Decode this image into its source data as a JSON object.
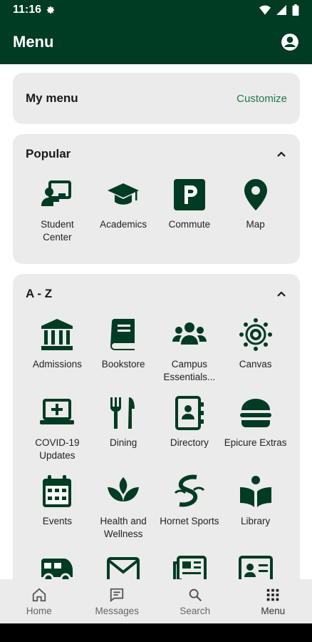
{
  "status": {
    "time": "11:16"
  },
  "appbar": {
    "title": "Menu",
    "account_icon": "account-circle-icon"
  },
  "mymenu": {
    "title": "My menu",
    "customize": "Customize"
  },
  "popular": {
    "title": "Popular",
    "items": [
      {
        "label": "Student Center",
        "icon": "student-center-icon"
      },
      {
        "label": "Academics",
        "icon": "graduation-cap-icon"
      },
      {
        "label": "Commute",
        "icon": "parking-icon"
      },
      {
        "label": "Map",
        "icon": "map-pin-icon"
      }
    ]
  },
  "az": {
    "title": "A - Z",
    "items": [
      {
        "label": "Admissions",
        "icon": "building-icon"
      },
      {
        "label": "Bookstore",
        "icon": "book-icon"
      },
      {
        "label": "Campus Essentials...",
        "icon": "users-icon"
      },
      {
        "label": "Canvas",
        "icon": "canvas-icon"
      },
      {
        "label": "COVID-19 Updates",
        "icon": "laptop-medical-icon"
      },
      {
        "label": "Dining",
        "icon": "utensils-icon"
      },
      {
        "label": "Directory",
        "icon": "address-book-icon"
      },
      {
        "label": "Epicure Extras",
        "icon": "burger-icon"
      },
      {
        "label": "Events",
        "icon": "calendar-icon"
      },
      {
        "label": "Health and Wellness",
        "icon": "leaf-icon"
      },
      {
        "label": "Hornet Sports",
        "icon": "hornet-sports-icon"
      },
      {
        "label": "Library",
        "icon": "reading-icon"
      },
      {
        "label": "",
        "icon": "shuttle-icon"
      },
      {
        "label": "",
        "icon": "envelope-icon"
      },
      {
        "label": "",
        "icon": "newspaper-icon"
      },
      {
        "label": "",
        "icon": "id-card-icon"
      }
    ]
  },
  "bottomnav": {
    "items": [
      {
        "label": "Home",
        "icon": "home-icon"
      },
      {
        "label": "Messages",
        "icon": "messages-icon"
      },
      {
        "label": "Search",
        "icon": "search-icon"
      },
      {
        "label": "Menu",
        "icon": "grid-menu-icon"
      }
    ]
  },
  "colors": {
    "brand": "#003b23",
    "accent": "#1e7a4a",
    "card": "#ebebeb"
  }
}
